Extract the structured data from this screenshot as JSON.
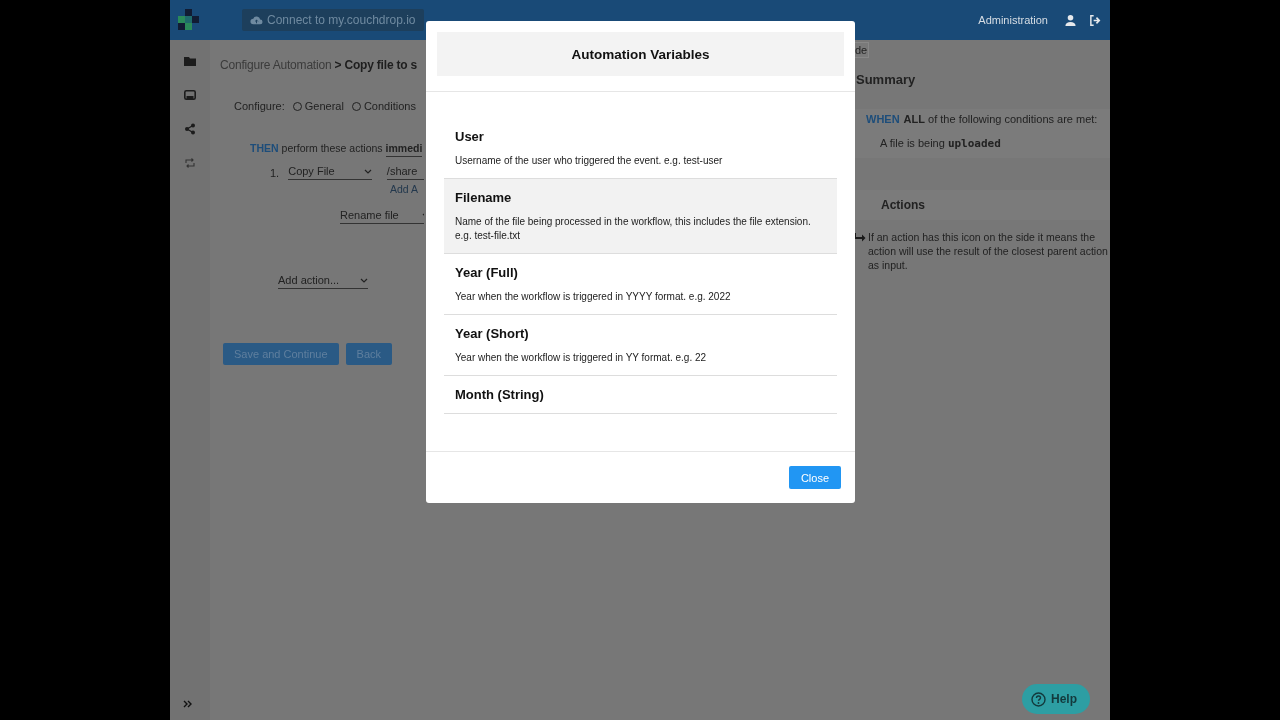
{
  "topbar": {
    "connect_button": "Connect to my.couchdrop.io",
    "admin_link": "Administration"
  },
  "page": {
    "breadcrumb": "Configure Automation **> Copy file to s**",
    "configure": {
      "label": "Configure:",
      "options": [
        {
          "label": "General",
          "selected": false
        },
        {
          "label": "Conditions",
          "selected": false
        }
      ]
    },
    "then": {
      "keyword": "THEN",
      "text": "perform these actions",
      "timing": "immedi"
    },
    "actions": [
      {
        "number": "1.",
        "type": "Copy File",
        "path": "/share",
        "add_link": "Add A"
      }
    ],
    "sub_action": "Rename file",
    "add_action": "Add action...",
    "buttons": [
      "Save and Continue",
      "Back"
    ]
  },
  "summary": {
    "button_fragment": "de",
    "title": "Summary",
    "when": "WHEN",
    "condition_intro": "**ALL** of the following conditions are met:",
    "condition": "A file is being **uploaded**",
    "actions_title": "Actions",
    "actions_note": "If an action has this icon on the side it means the action will use the result of the closest parent action as input."
  },
  "modal": {
    "title": "Automation Variables",
    "variables": [
      {
        "name": "User",
        "description": "Username of the user who triggered the event. e.g. test-user",
        "highlighted": false
      },
      {
        "name": "Filename",
        "description": "Name of the file being processed in the workflow, this includes the file extension. e.g. test-file.txt",
        "highlighted": true
      },
      {
        "name": "Year (Full)",
        "description": "Year when the workflow is triggered in YYYY format. e.g. 2022",
        "highlighted": false
      },
      {
        "name": "Year (Short)",
        "description": "Year when the workflow is triggered in YY format. e.g. 22",
        "highlighted": false
      },
      {
        "name": "Month (String)",
        "highlighted": false
      }
    ],
    "close": "Close"
  },
  "help": "Help"
}
